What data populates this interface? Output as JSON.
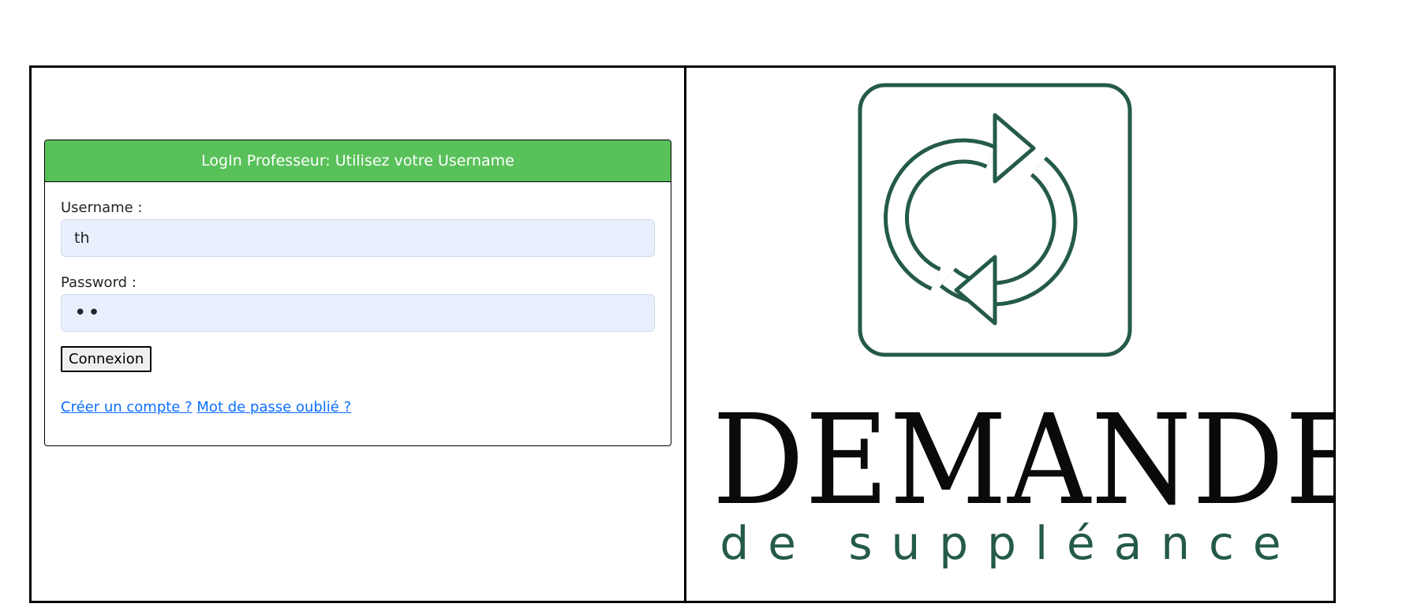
{
  "login": {
    "header": "LogIn Professeur: Utilisez votre Username",
    "username_label": "Username :",
    "username_value": "th",
    "password_label": "Password :",
    "password_value": "••",
    "submit_label": "Connexion",
    "create_account_link": "Créer un compte ?",
    "forgot_password_link": "Mot de passe oublié ?"
  },
  "logo": {
    "title": "DEMANDE",
    "subtitle": "de suppléance",
    "icon": "refresh-icon",
    "color": "#245b46"
  },
  "colors": {
    "header_green": "#59c15a",
    "input_bg": "#e8f0fe",
    "link": "#0d6efd"
  }
}
